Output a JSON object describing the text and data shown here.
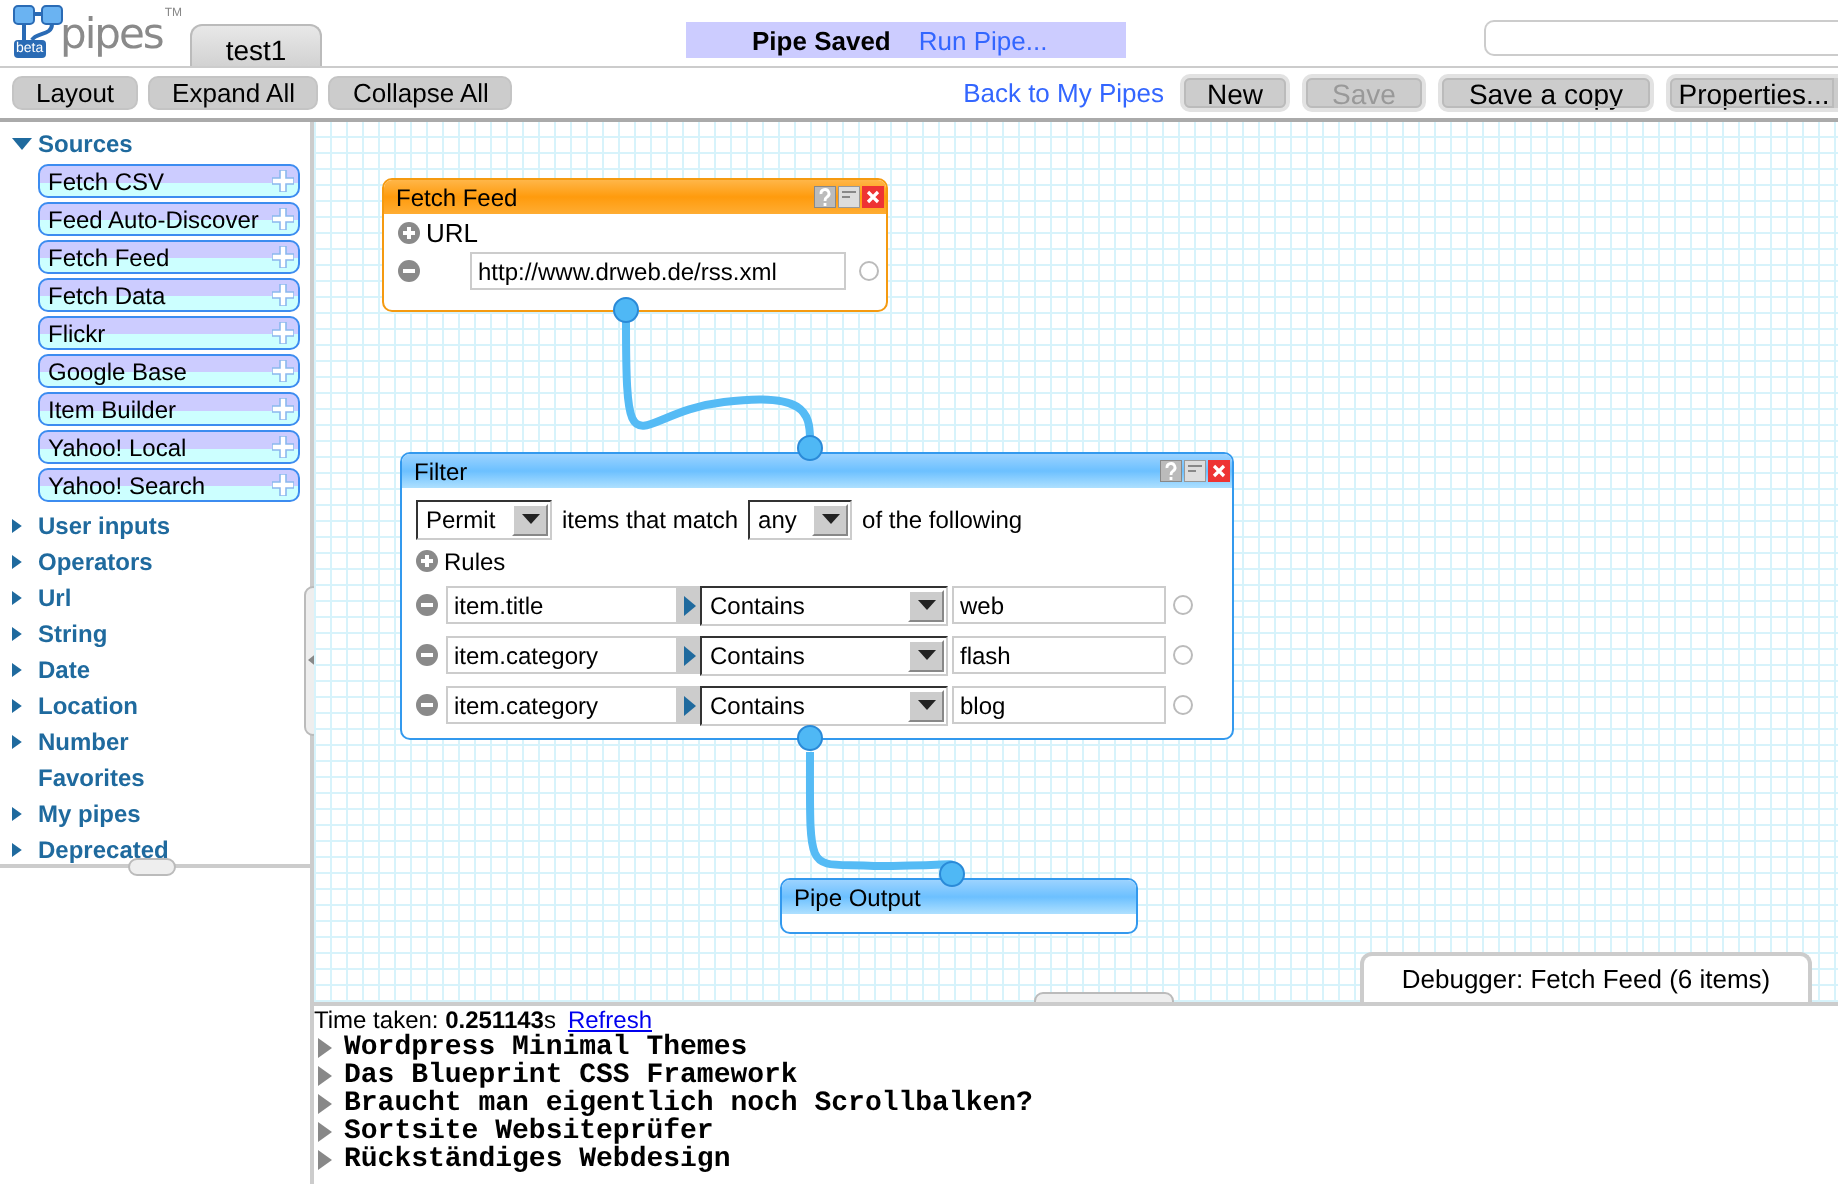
{
  "logo": {
    "name": "pipes",
    "badge": "beta",
    "mark": "TM"
  },
  "tabs": [
    {
      "label": "test1",
      "selected": true
    }
  ],
  "status": {
    "message": "Pipe Saved",
    "link": "Run Pipe..."
  },
  "toolbar_left": [
    "Layout",
    "Expand All",
    "Collapse All"
  ],
  "toolbar_right": {
    "link": "Back to My Pipes",
    "buttons": [
      {
        "label": "New",
        "disabled": false
      },
      {
        "label": "Save",
        "disabled": true
      },
      {
        "label": "Save a copy",
        "disabled": false
      },
      {
        "label": "Properties...",
        "disabled": false
      }
    ]
  },
  "sidebar": {
    "sections": [
      {
        "label": "Sources",
        "kind": "folder",
        "expanded": true,
        "items": [
          "Fetch CSV",
          "Feed Auto-Discover",
          "Fetch Feed",
          "Fetch Data",
          "Flickr",
          "Google Base",
          "Item Builder",
          "Yahoo! Local",
          "Yahoo! Search"
        ]
      },
      {
        "label": "User inputs",
        "kind": "folder",
        "expanded": false
      },
      {
        "label": "Operators",
        "kind": "folder",
        "expanded": false
      },
      {
        "label": "Url",
        "kind": "folder",
        "expanded": false
      },
      {
        "label": "String",
        "kind": "folder",
        "expanded": false
      },
      {
        "label": "Date",
        "kind": "folder",
        "expanded": false
      },
      {
        "label": "Location",
        "kind": "folder",
        "expanded": false
      },
      {
        "label": "Number",
        "kind": "folder",
        "expanded": false
      },
      {
        "label": "Favorites",
        "kind": "plain"
      },
      {
        "label": "My pipes",
        "kind": "folder",
        "expanded": false
      },
      {
        "label": "Deprecated",
        "kind": "folder",
        "expanded": false
      }
    ]
  },
  "modules": [
    {
      "kind": "fetch",
      "title": "Fetch Feed",
      "url_label": "URL",
      "url": "http://www.drweb.de/rss.xml"
    },
    {
      "kind": "filter",
      "title": "Filter",
      "mode": "Permit",
      "text_1": "items that match",
      "match": "any",
      "text_2": "of the following",
      "rules_label": "Rules",
      "rules": [
        {
          "field": "item.title",
          "operator": "Contains",
          "value": "web"
        },
        {
          "field": "item.category",
          "operator": "Contains",
          "value": "flash"
        },
        {
          "field": "item.category",
          "operator": "Contains",
          "value": "blog"
        }
      ]
    },
    {
      "kind": "output",
      "title": "Pipe Output"
    }
  ],
  "debugger": {
    "tab": "Debugger: Fetch Feed (6 items)",
    "time": "Time taken: **0.251143**s",
    "refresh": "Refresh",
    "items": [
      "Wordpress Minimal Themes",
      "Das Blueprint CSS Framework",
      "Braucht man eigentlich noch Scrollbalken?",
      "Sortsite Websiteprüfer",
      "Rückständiges Webdesign"
    ]
  }
}
